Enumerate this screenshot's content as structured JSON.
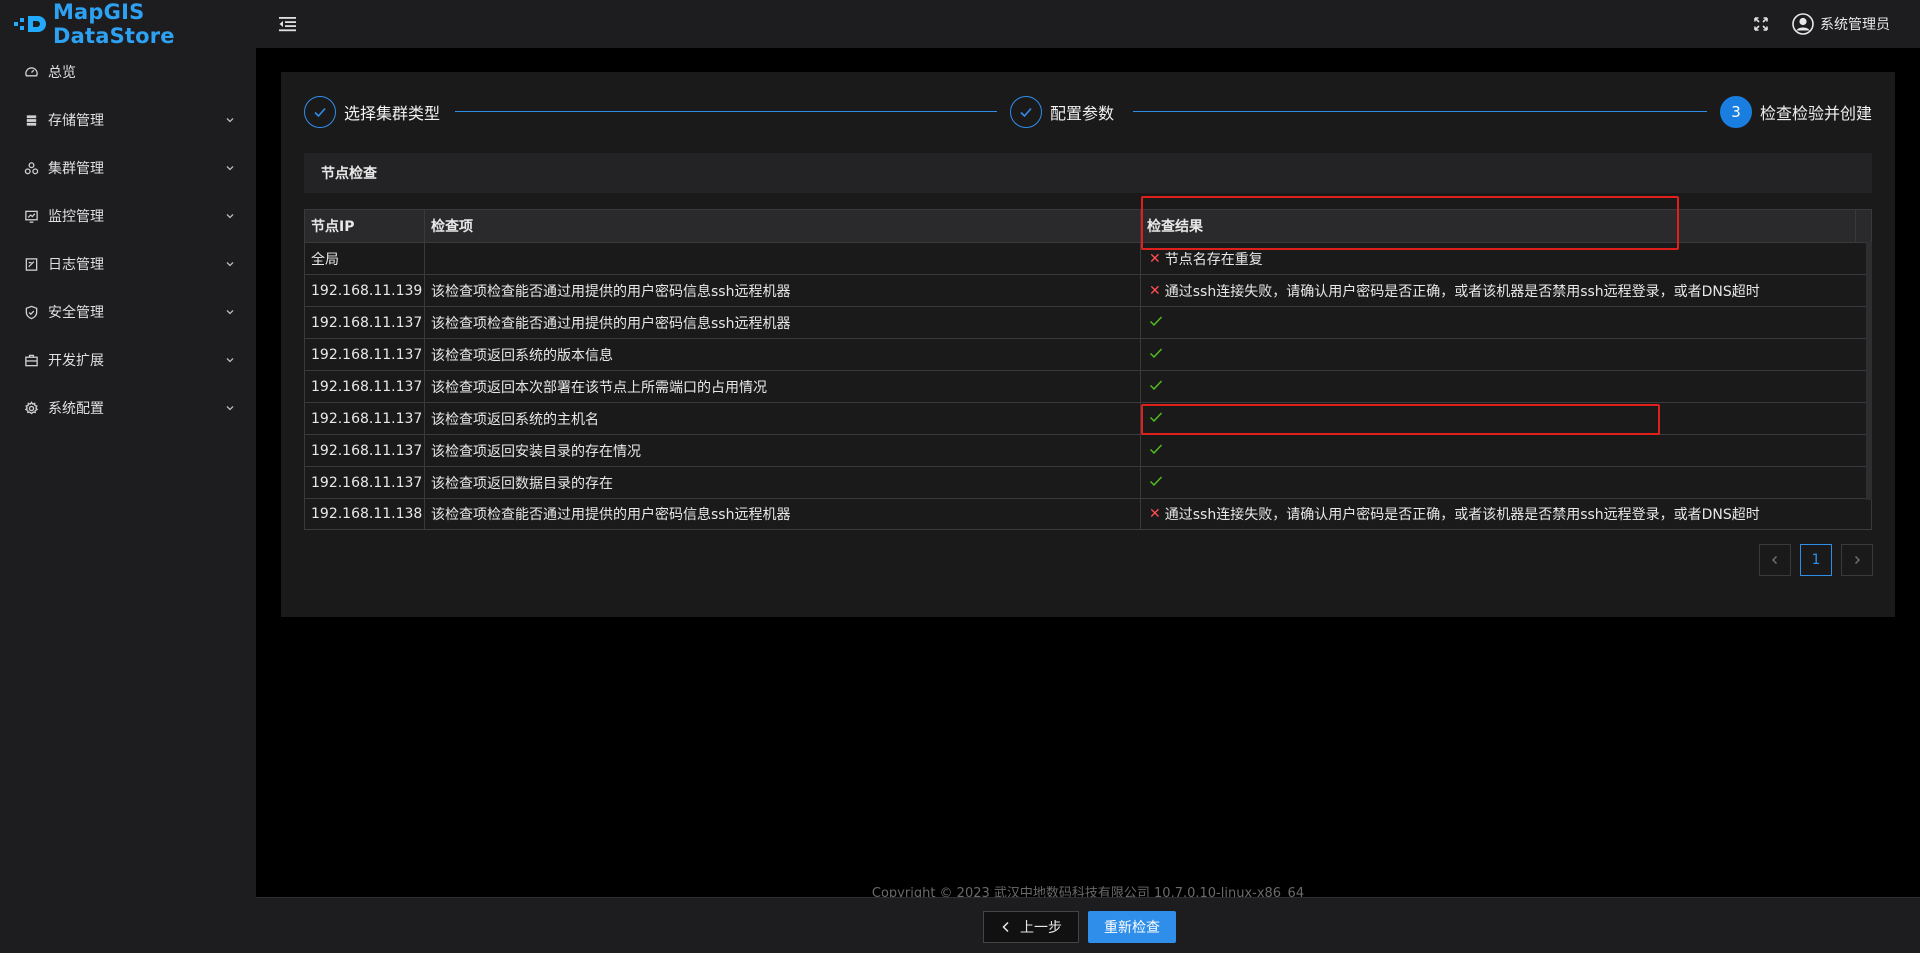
{
  "app": {
    "title": "MapGIS DataStore",
    "accent": "#2f8eea"
  },
  "sidebar": {
    "items": [
      {
        "label": "总览",
        "icon": "dashboard-icon",
        "expandable": false
      },
      {
        "label": "存储管理",
        "icon": "database-icon",
        "expandable": true
      },
      {
        "label": "集群管理",
        "icon": "cluster-icon",
        "expandable": true
      },
      {
        "label": "监控管理",
        "icon": "monitor-icon",
        "expandable": true
      },
      {
        "label": "日志管理",
        "icon": "log-icon",
        "expandable": true
      },
      {
        "label": "安全管理",
        "icon": "shield-icon",
        "expandable": true
      },
      {
        "label": "开发扩展",
        "icon": "toolbox-icon",
        "expandable": true
      },
      {
        "label": "系统配置",
        "icon": "gear-icon",
        "expandable": true
      }
    ]
  },
  "header": {
    "user_name": "系统管理员"
  },
  "steps": [
    {
      "label": "选择集群类型",
      "status": "done"
    },
    {
      "label": "配置参数",
      "status": "done"
    },
    {
      "label": "检查检验并创建",
      "status": "active",
      "number": "3"
    }
  ],
  "section": {
    "title": "节点检查"
  },
  "table": {
    "headers": [
      "节点IP",
      "检查项",
      "检查结果"
    ],
    "rows": [
      {
        "ip": "全局",
        "item": "",
        "ok": false,
        "result": "节点名存在重复"
      },
      {
        "ip": "192.168.11.139",
        "item": "该检查项检查能否通过用提供的用户密码信息ssh远程机器",
        "ok": false,
        "result": "通过ssh连接失败，请确认用户密码是否正确，或者该机器是否禁用ssh远程登录，或者DNS超时"
      },
      {
        "ip": "192.168.11.137",
        "item": "该检查项检查能否通过用提供的用户密码信息ssh远程机器",
        "ok": true,
        "result": ""
      },
      {
        "ip": "192.168.11.137",
        "item": "该检查项返回系统的版本信息",
        "ok": true,
        "result": ""
      },
      {
        "ip": "192.168.11.137",
        "item": "该检查项返回本次部署在该节点上所需端口的占用情况",
        "ok": true,
        "result": ""
      },
      {
        "ip": "192.168.11.137",
        "item": "该检查项返回系统的主机名",
        "ok": true,
        "result": ""
      },
      {
        "ip": "192.168.11.137",
        "item": "该检查项返回安装目录的存在情况",
        "ok": true,
        "result": ""
      },
      {
        "ip": "192.168.11.137",
        "item": "该检查项返回数据目录的存在",
        "ok": true,
        "result": ""
      },
      {
        "ip": "192.168.11.138",
        "item": "该检查项检查能否通过用提供的用户密码信息ssh远程机器",
        "ok": false,
        "result": "通过ssh连接失败，请确认用户密码是否正确，或者该机器是否禁用ssh远程登录，或者DNS超时"
      }
    ]
  },
  "pagination": {
    "current_page": "1"
  },
  "footer": {
    "copyright": "Copyright © 2023 武汉中地数码科技有限公司 10.7.0.10-linux-x86_64",
    "prev_label": "上一步",
    "recheck_label": "重新检查"
  }
}
